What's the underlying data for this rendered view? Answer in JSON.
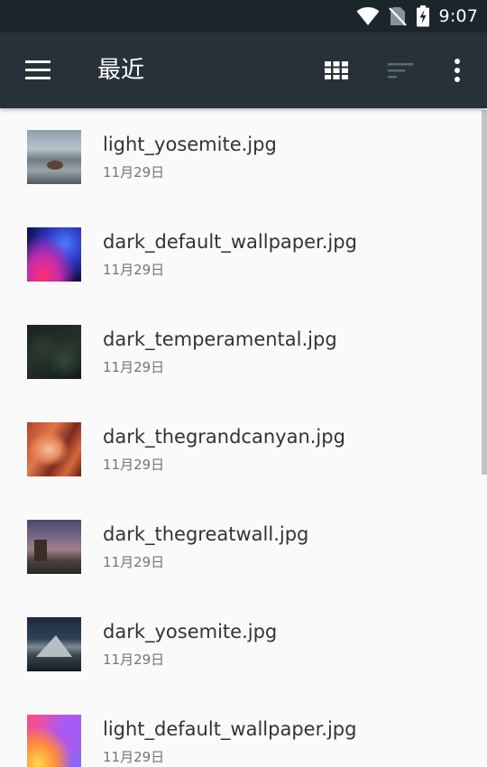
{
  "status_bar": {
    "time": "9:07"
  },
  "app_bar": {
    "title": "最近",
    "icons": [
      "menu-icon",
      "grid-view-icon",
      "sort-icon",
      "more-options-icon"
    ]
  },
  "files": [
    {
      "name": "light_yosemite.jpg",
      "date": "11月29日"
    },
    {
      "name": "dark_default_wallpaper.jpg",
      "date": "11月29日"
    },
    {
      "name": "dark_temperamental.jpg",
      "date": "11月29日"
    },
    {
      "name": "dark_thegrandcanyan.jpg",
      "date": "11月29日"
    },
    {
      "name": "dark_thegreatwall.jpg",
      "date": "11月29日"
    },
    {
      "name": "dark_yosemite.jpg",
      "date": "11月29日"
    },
    {
      "name": "light_default_wallpaper.jpg",
      "date": "11月29日"
    }
  ],
  "colors": {
    "status_bar": "#1b252c",
    "app_bar": "#263238",
    "background": "#fafafa"
  }
}
